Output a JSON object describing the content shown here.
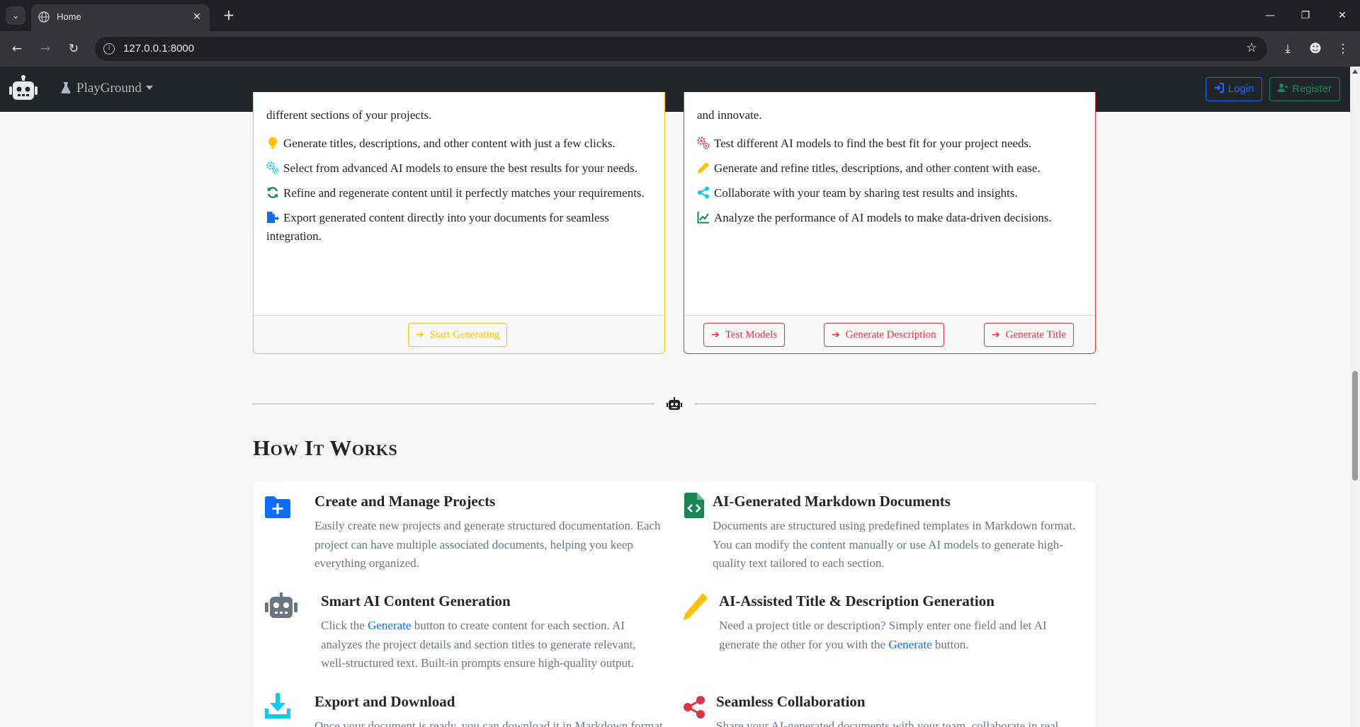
{
  "browser": {
    "tab_title": "Home",
    "url": "127.0.0.1:8000",
    "tab_menu_icon": "chevron-down-icon",
    "new_tab_icon": "plus-icon"
  },
  "navbar": {
    "brand_icon": "robot-icon",
    "playground_label": "PlayGround",
    "login_label": "Login",
    "register_label": "Register",
    "colors": {
      "bg": "#212529",
      "login": "#0d6efd",
      "register": "#198754"
    }
  },
  "generate_card": {
    "intro": "different sections of your projects.",
    "features": [
      {
        "icon": "lightbulb-icon",
        "text": "Generate titles, descriptions, and other content with just a few clicks."
      },
      {
        "icon": "gears-icon",
        "text": "Select from advanced AI models to ensure the best results for your needs."
      },
      {
        "icon": "sync-icon",
        "text": "Refine and regenerate content until it perfectly matches your requirements."
      },
      {
        "icon": "file-export-icon",
        "text": "Export generated content directly into your documents for seamless integration."
      }
    ],
    "button_label": "Start Generating",
    "accent": "#ffc107"
  },
  "playground_card": {
    "intro": "and innovate.",
    "features": [
      {
        "icon": "gears-icon",
        "text": "Test different AI models to find the best fit for your project needs."
      },
      {
        "icon": "pencil-icon",
        "text": "Generate and refine titles, descriptions, and other content with ease."
      },
      {
        "icon": "share-icon",
        "text": "Collaborate with your team by sharing test results and insights."
      },
      {
        "icon": "chart-line-icon",
        "text": "Analyze the performance of AI models to make data-driven decisions."
      }
    ],
    "buttons": [
      "Test Models",
      "Generate Description",
      "Generate Title"
    ],
    "accent": "#dc3545"
  },
  "how_it_works": {
    "title": "How It Works",
    "items": [
      {
        "icon": "folder-plus-icon",
        "title": "Create and Manage Projects",
        "text": "Easily create new projects and generate structured documentation. Each project can have multiple associated documents, helping you keep everything organized."
      },
      {
        "icon": "file-code-icon",
        "title": "AI-Generated Markdown Documents",
        "text": "Documents are structured using predefined templates in Markdown format. You can modify the content manually or use AI models to generate high-quality text tailored to each section."
      },
      {
        "icon": "robot-icon",
        "title": "Smart AI Content Generation",
        "text_before": "Click the ",
        "link": "Generate",
        "text_after": " button to create content for each section. AI analyzes the project details and section titles to generate relevant, well-structured text. Built-in prompts ensure high-quality output."
      },
      {
        "icon": "pencil-icon",
        "title": "AI-Assisted Title & Description Generation",
        "text_before": "Need a project title or description? Simply enter one field and let AI generate the other for you with the ",
        "link": "Generate",
        "text_after": " button."
      },
      {
        "icon": "download-icon",
        "title": "Export and Download",
        "text": "Once your document is ready, you can download it in Markdown format"
      },
      {
        "icon": "share-icon",
        "title": "Seamless Collaboration",
        "text": "Share your AI-generated documents with your team, collaborate in real"
      }
    ]
  }
}
